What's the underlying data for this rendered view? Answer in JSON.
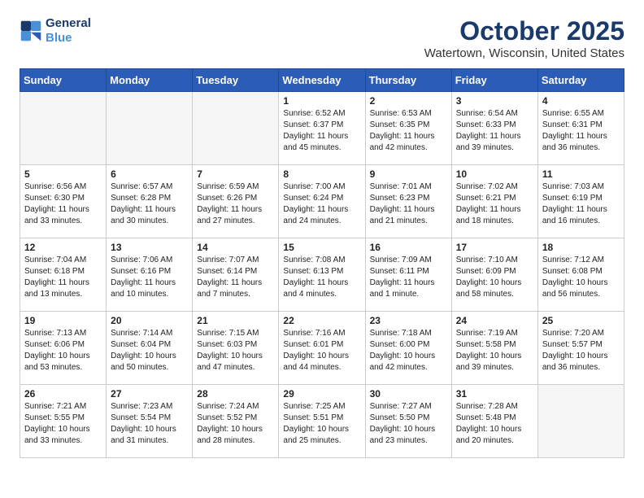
{
  "logo": {
    "line1": "General",
    "line2": "Blue"
  },
  "title": "October 2025",
  "subtitle": "Watertown, Wisconsin, United States",
  "days_of_week": [
    "Sunday",
    "Monday",
    "Tuesday",
    "Wednesday",
    "Thursday",
    "Friday",
    "Saturday"
  ],
  "weeks": [
    [
      {
        "day": "",
        "empty": true
      },
      {
        "day": "",
        "empty": true
      },
      {
        "day": "",
        "empty": true
      },
      {
        "day": "1",
        "sunrise": "6:52 AM",
        "sunset": "6:37 PM",
        "daylight": "11 hours and 45 minutes."
      },
      {
        "day": "2",
        "sunrise": "6:53 AM",
        "sunset": "6:35 PM",
        "daylight": "11 hours and 42 minutes."
      },
      {
        "day": "3",
        "sunrise": "6:54 AM",
        "sunset": "6:33 PM",
        "daylight": "11 hours and 39 minutes."
      },
      {
        "day": "4",
        "sunrise": "6:55 AM",
        "sunset": "6:31 PM",
        "daylight": "11 hours and 36 minutes."
      }
    ],
    [
      {
        "day": "5",
        "sunrise": "6:56 AM",
        "sunset": "6:30 PM",
        "daylight": "11 hours and 33 minutes."
      },
      {
        "day": "6",
        "sunrise": "6:57 AM",
        "sunset": "6:28 PM",
        "daylight": "11 hours and 30 minutes."
      },
      {
        "day": "7",
        "sunrise": "6:59 AM",
        "sunset": "6:26 PM",
        "daylight": "11 hours and 27 minutes."
      },
      {
        "day": "8",
        "sunrise": "7:00 AM",
        "sunset": "6:24 PM",
        "daylight": "11 hours and 24 minutes."
      },
      {
        "day": "9",
        "sunrise": "7:01 AM",
        "sunset": "6:23 PM",
        "daylight": "11 hours and 21 minutes."
      },
      {
        "day": "10",
        "sunrise": "7:02 AM",
        "sunset": "6:21 PM",
        "daylight": "11 hours and 18 minutes."
      },
      {
        "day": "11",
        "sunrise": "7:03 AM",
        "sunset": "6:19 PM",
        "daylight": "11 hours and 16 minutes."
      }
    ],
    [
      {
        "day": "12",
        "sunrise": "7:04 AM",
        "sunset": "6:18 PM",
        "daylight": "11 hours and 13 minutes."
      },
      {
        "day": "13",
        "sunrise": "7:06 AM",
        "sunset": "6:16 PM",
        "daylight": "11 hours and 10 minutes."
      },
      {
        "day": "14",
        "sunrise": "7:07 AM",
        "sunset": "6:14 PM",
        "daylight": "11 hours and 7 minutes."
      },
      {
        "day": "15",
        "sunrise": "7:08 AM",
        "sunset": "6:13 PM",
        "daylight": "11 hours and 4 minutes."
      },
      {
        "day": "16",
        "sunrise": "7:09 AM",
        "sunset": "6:11 PM",
        "daylight": "11 hours and 1 minute."
      },
      {
        "day": "17",
        "sunrise": "7:10 AM",
        "sunset": "6:09 PM",
        "daylight": "10 hours and 58 minutes."
      },
      {
        "day": "18",
        "sunrise": "7:12 AM",
        "sunset": "6:08 PM",
        "daylight": "10 hours and 56 minutes."
      }
    ],
    [
      {
        "day": "19",
        "sunrise": "7:13 AM",
        "sunset": "6:06 PM",
        "daylight": "10 hours and 53 minutes."
      },
      {
        "day": "20",
        "sunrise": "7:14 AM",
        "sunset": "6:04 PM",
        "daylight": "10 hours and 50 minutes."
      },
      {
        "day": "21",
        "sunrise": "7:15 AM",
        "sunset": "6:03 PM",
        "daylight": "10 hours and 47 minutes."
      },
      {
        "day": "22",
        "sunrise": "7:16 AM",
        "sunset": "6:01 PM",
        "daylight": "10 hours and 44 minutes."
      },
      {
        "day": "23",
        "sunrise": "7:18 AM",
        "sunset": "6:00 PM",
        "daylight": "10 hours and 42 minutes."
      },
      {
        "day": "24",
        "sunrise": "7:19 AM",
        "sunset": "5:58 PM",
        "daylight": "10 hours and 39 minutes."
      },
      {
        "day": "25",
        "sunrise": "7:20 AM",
        "sunset": "5:57 PM",
        "daylight": "10 hours and 36 minutes."
      }
    ],
    [
      {
        "day": "26",
        "sunrise": "7:21 AM",
        "sunset": "5:55 PM",
        "daylight": "10 hours and 33 minutes."
      },
      {
        "day": "27",
        "sunrise": "7:23 AM",
        "sunset": "5:54 PM",
        "daylight": "10 hours and 31 minutes."
      },
      {
        "day": "28",
        "sunrise": "7:24 AM",
        "sunset": "5:52 PM",
        "daylight": "10 hours and 28 minutes."
      },
      {
        "day": "29",
        "sunrise": "7:25 AM",
        "sunset": "5:51 PM",
        "daylight": "10 hours and 25 minutes."
      },
      {
        "day": "30",
        "sunrise": "7:27 AM",
        "sunset": "5:50 PM",
        "daylight": "10 hours and 23 minutes."
      },
      {
        "day": "31",
        "sunrise": "7:28 AM",
        "sunset": "5:48 PM",
        "daylight": "10 hours and 20 minutes."
      },
      {
        "day": "",
        "empty": true
      }
    ]
  ],
  "labels": {
    "sunrise": "Sunrise:",
    "sunset": "Sunset:",
    "daylight": "Daylight hours"
  }
}
